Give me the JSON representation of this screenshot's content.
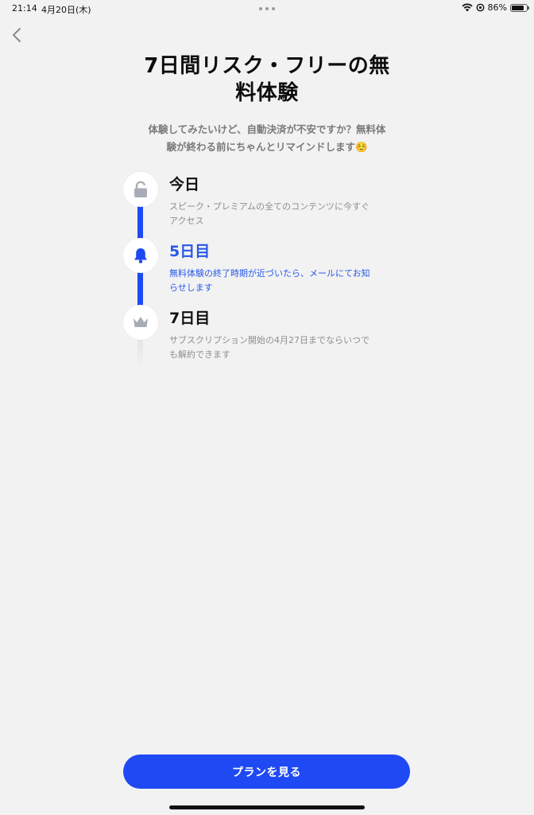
{
  "status_bar": {
    "time": "21:14",
    "date": "4月20日(木)",
    "battery_text": "86%",
    "battery_level": 0.86
  },
  "header": {
    "title_line1": "7日間リスク・フリーの無",
    "title_line2": "料体験",
    "subtitle_line1": "体験してみたいけど、自動決済が不安ですか？無料体",
    "subtitle_line2": "験が終わる前にちゃんとリマインドします☺️"
  },
  "timeline": [
    {
      "icon": "unlock-icon",
      "title": "今日",
      "desc_line1": "スピーク・プレミアムの全てのコンテンツに今すぐ",
      "desc_line2": "アクセス"
    },
    {
      "icon": "bell-icon",
      "title": "5日目",
      "desc_line1": "無料体験の終了時期が近づいたら、メールにてお知",
      "desc_line2": "らせします"
    },
    {
      "icon": "crown-icon",
      "title": "7日目",
      "desc_line1": "サブスクリプション開始の4月27日までならいつで",
      "desc_line2": "も解約できます"
    }
  ],
  "cta": {
    "label": "プランを見る"
  },
  "colors": {
    "accent": "#1f49f3",
    "active_text": "#2858e8",
    "muted_text": "#8e8e8e",
    "background": "#f2f2f2"
  }
}
